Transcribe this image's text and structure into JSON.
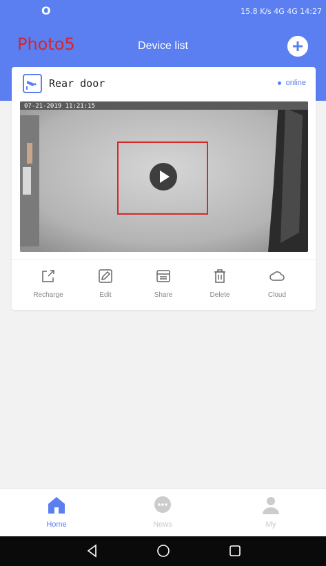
{
  "status_bar": {
    "carrier_line1": "",
    "carrier_line2": "",
    "right_text": "15.8 K/s 4G 4G 14:27",
    "indicator": "O"
  },
  "header": {
    "logo": "Photo5",
    "title": "Device list",
    "add_icon": "plus-icon"
  },
  "device": {
    "name": "Rear door",
    "status": "online",
    "timestamp": "07-21-2019 11:21:15"
  },
  "actions": [
    {
      "label": "Recharge",
      "icon": "share-out-icon"
    },
    {
      "label": "Edit",
      "icon": "pencil-icon"
    },
    {
      "label": "Share",
      "icon": "share-list-icon"
    },
    {
      "label": "Delete",
      "icon": "trash-icon"
    },
    {
      "label": "Cloud",
      "icon": "cloud-icon"
    }
  ],
  "tabs": [
    {
      "label": "Home",
      "icon": "home-icon",
      "active": true
    },
    {
      "label": "News",
      "icon": "chat-icon",
      "active": false
    },
    {
      "label": "My",
      "icon": "user-icon",
      "active": false
    }
  ],
  "colors": {
    "accent": "#5b7ff0",
    "logo": "#d8242c",
    "highlight": "#d42a2a",
    "inactive": "#c8c8c8"
  }
}
